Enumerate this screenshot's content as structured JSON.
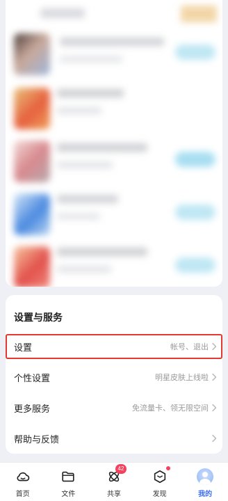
{
  "settings": {
    "title": "设置与服务",
    "rows": [
      {
        "label": "设置",
        "desc": "帐号、退出"
      },
      {
        "label": "个性设置",
        "desc": "明星皮肤上线啦"
      },
      {
        "label": "更多服务",
        "desc": "免流量卡、领无限空间"
      },
      {
        "label": "帮助与反馈",
        "desc": ""
      }
    ]
  },
  "tabbar": {
    "tabs": [
      {
        "label": "首页",
        "icon": "cloud-icon"
      },
      {
        "label": "文件",
        "icon": "folder-icon"
      },
      {
        "label": "共享",
        "icon": "share-atom-icon",
        "badge": "42"
      },
      {
        "label": "发现",
        "icon": "cube-icon"
      },
      {
        "label": "我的",
        "icon": "avatar"
      }
    ],
    "active_index": 4
  },
  "colors": {
    "accent": "#3d6ff5",
    "highlight_border": "#e23a2f",
    "badge": "#f5405e"
  }
}
